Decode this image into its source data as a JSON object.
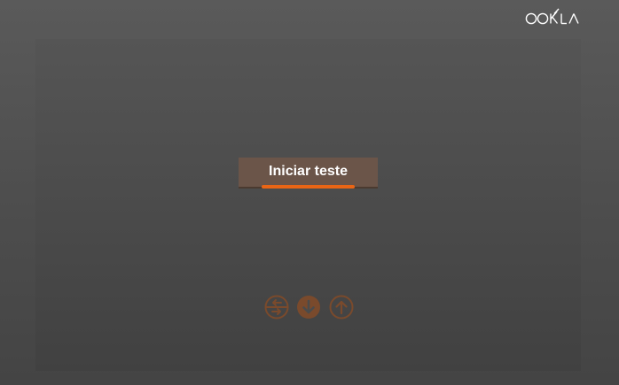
{
  "branding": {
    "logo_text": "OOKLA",
    "logo_color": "#ffffff"
  },
  "main": {
    "start_button_label": "Iniciar teste",
    "accent_color": "#ea6515",
    "button_color": "#6b5549"
  },
  "icons": [
    {
      "name": "ping-icon",
      "glyph": "left-right arrows"
    },
    {
      "name": "download-icon",
      "glyph": "down arrow"
    },
    {
      "name": "upload-icon",
      "glyph": "up arrow"
    }
  ]
}
